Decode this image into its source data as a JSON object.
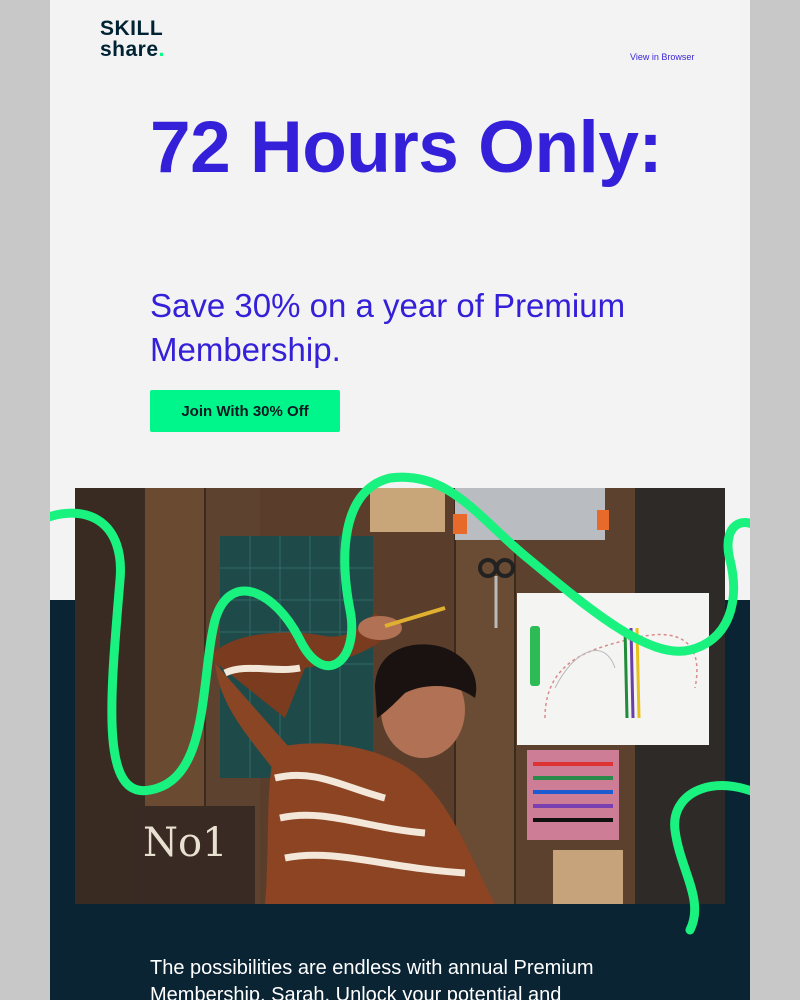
{
  "brand": {
    "logo_line1": "SKILL",
    "logo_line2": "share",
    "logo_dot": ".",
    "accent_green": "#00ff84",
    "accent_blue": "#3520d9",
    "dark_navy": "#0a2434"
  },
  "header": {
    "view_in_browser": "View in Browser"
  },
  "hero": {
    "headline": "72 Hours Only:",
    "subhead": "Save 30% on a year of Premium Membership.",
    "cta_label": "Join With 30% Off"
  },
  "image": {
    "description_icon": "photo-woman-at-craft-desk",
    "sign_text": "No1"
  },
  "body": {
    "paragraph": "The possibilities are endless with annual Premium Membership, Sarah. Unlock your potential and"
  }
}
